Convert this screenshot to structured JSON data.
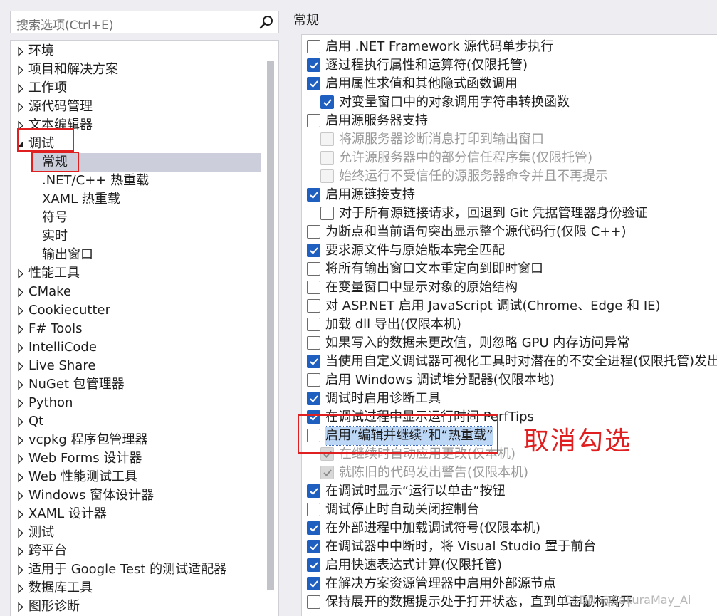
{
  "search": {
    "placeholder": "搜索选项(Ctrl+E)",
    "icon": "search-icon"
  },
  "page_title": "常规",
  "tree": [
    {
      "label": "环境",
      "level": 0,
      "state": "collapsed"
    },
    {
      "label": "项目和解决方案",
      "level": 0,
      "state": "collapsed"
    },
    {
      "label": "工作项",
      "level": 0,
      "state": "collapsed"
    },
    {
      "label": "源代码管理",
      "level": 0,
      "state": "collapsed"
    },
    {
      "label": "文本编辑器",
      "level": 0,
      "state": "collapsed"
    },
    {
      "label": "调试",
      "level": 0,
      "state": "expanded"
    },
    {
      "label": "常规",
      "level": 1,
      "selected": true
    },
    {
      "label": ".NET/C++ 热重载",
      "level": 1
    },
    {
      "label": "XAML 热重载",
      "level": 1
    },
    {
      "label": "符号",
      "level": 1
    },
    {
      "label": "实时",
      "level": 1
    },
    {
      "label": "输出窗口",
      "level": 1
    },
    {
      "label": "性能工具",
      "level": 0,
      "state": "collapsed"
    },
    {
      "label": "CMake",
      "level": 0,
      "state": "collapsed"
    },
    {
      "label": "Cookiecutter",
      "level": 0,
      "state": "collapsed"
    },
    {
      "label": "F# Tools",
      "level": 0,
      "state": "collapsed"
    },
    {
      "label": "IntelliCode",
      "level": 0,
      "state": "collapsed"
    },
    {
      "label": "Live Share",
      "level": 0,
      "state": "collapsed"
    },
    {
      "label": "NuGet 包管理器",
      "level": 0,
      "state": "collapsed"
    },
    {
      "label": "Python",
      "level": 0,
      "state": "collapsed"
    },
    {
      "label": "Qt",
      "level": 0,
      "state": "collapsed"
    },
    {
      "label": "vcpkg 程序包管理器",
      "level": 0,
      "state": "collapsed"
    },
    {
      "label": "Web Forms 设计器",
      "level": 0,
      "state": "collapsed"
    },
    {
      "label": "Web 性能测试工具",
      "level": 0,
      "state": "collapsed"
    },
    {
      "label": "Windows 窗体设计器",
      "level": 0,
      "state": "collapsed"
    },
    {
      "label": "XAML 设计器",
      "level": 0,
      "state": "collapsed"
    },
    {
      "label": "测试",
      "level": 0,
      "state": "collapsed"
    },
    {
      "label": "跨平台",
      "level": 0,
      "state": "collapsed"
    },
    {
      "label": "适用于 Google Test 的测试适配器",
      "level": 0,
      "state": "collapsed"
    },
    {
      "label": "数据库工具",
      "level": 0,
      "state": "collapsed"
    },
    {
      "label": "图形诊断",
      "level": 0,
      "state": "collapsed"
    }
  ],
  "options": [
    {
      "label": "启用 .NET Framework 源代码单步执行",
      "checked": false,
      "indent": 0
    },
    {
      "label": "逐过程执行属性和运算符(仅限托管)",
      "checked": true,
      "indent": 0
    },
    {
      "label": "启用属性求值和其他隐式函数调用",
      "checked": true,
      "indent": 0
    },
    {
      "label": "对变量窗口中的对象调用字符串转换函数",
      "checked": true,
      "indent": 1
    },
    {
      "label": "启用源服务器支持",
      "checked": false,
      "indent": 0
    },
    {
      "label": "将源服务器诊断消息打印到输出窗口",
      "checked": false,
      "indent": 1,
      "disabled": true
    },
    {
      "label": "允许源服务器中的部分信任程序集(仅限托管)",
      "checked": false,
      "indent": 1,
      "disabled": true
    },
    {
      "label": "始终运行不受信任的源服务器命令并且不再提示",
      "checked": false,
      "indent": 1,
      "disabled": true
    },
    {
      "label": "启用源链接支持",
      "checked": true,
      "indent": 0
    },
    {
      "label": "对于所有源链接请求，回退到 Git 凭据管理器身份验证",
      "checked": false,
      "indent": 1
    },
    {
      "label": "为断点和当前语句突出显示整个源代码行(仅限 C++)",
      "checked": false,
      "indent": 0
    },
    {
      "label": "要求源文件与原始版本完全匹配",
      "checked": true,
      "indent": 0
    },
    {
      "label": "将所有输出窗口文本重定向到即时窗口",
      "checked": false,
      "indent": 0
    },
    {
      "label": "在变量窗口中显示对象的原始结构",
      "checked": false,
      "indent": 0
    },
    {
      "label": "对 ASP.NET 启用 JavaScript 调试(Chrome、Edge 和 IE)",
      "checked": false,
      "indent": 0
    },
    {
      "label": "加载 dll 导出(仅限本机)",
      "checked": false,
      "indent": 0
    },
    {
      "label": "如果写入的数据未更改值，则忽略 GPU 内存访问异常",
      "checked": false,
      "indent": 0
    },
    {
      "label": "当使用自定义调试器可视化工具时对潜在的不安全进程(仅限托管)发出",
      "checked": true,
      "indent": 0
    },
    {
      "label": "启用 Windows 调试堆分配器(仅限本地)",
      "checked": false,
      "indent": 0
    },
    {
      "label": "调试时启用诊断工具",
      "checked": true,
      "indent": 0
    },
    {
      "label": "在调试过程中显示运行时间 PerfTips",
      "checked": true,
      "indent": 0
    },
    {
      "label": "启用“编辑并继续”和“热重载”",
      "checked": false,
      "indent": 0,
      "focused": true
    },
    {
      "label": "在继续时自动应用更改(仅本机)",
      "checked": true,
      "indent": 1,
      "disabled": true
    },
    {
      "label": "就陈旧的代码发出警告(仅限本机)",
      "checked": true,
      "indent": 1,
      "disabled": true
    },
    {
      "label": "在调试时显示“运行以单击”按钮",
      "checked": true,
      "indent": 0
    },
    {
      "label": "调试停止时自动关闭控制台",
      "checked": false,
      "indent": 0
    },
    {
      "label": "在外部进程中加载调试符号(仅限本机)",
      "checked": true,
      "indent": 0
    },
    {
      "label": "在调试器中中断时，将 Visual Studio 置于前台",
      "checked": true,
      "indent": 0
    },
    {
      "label": "启用快速表达式计算(仅限托管)",
      "checked": true,
      "indent": 0
    },
    {
      "label": "在解决方案资源管理器中启用外部源节点",
      "checked": true,
      "indent": 0
    },
    {
      "label": "保持展开的数据提示处于打开状态，直到单击鼠标离开",
      "checked": false,
      "indent": 0
    }
  ],
  "annotation": "取消勾选",
  "watermark": "CSDN @SakuraMay_Ai",
  "colors": {
    "accent": "#1f5fbf",
    "annotation_red": "#e02020",
    "selected_bg": "#cccedb"
  }
}
